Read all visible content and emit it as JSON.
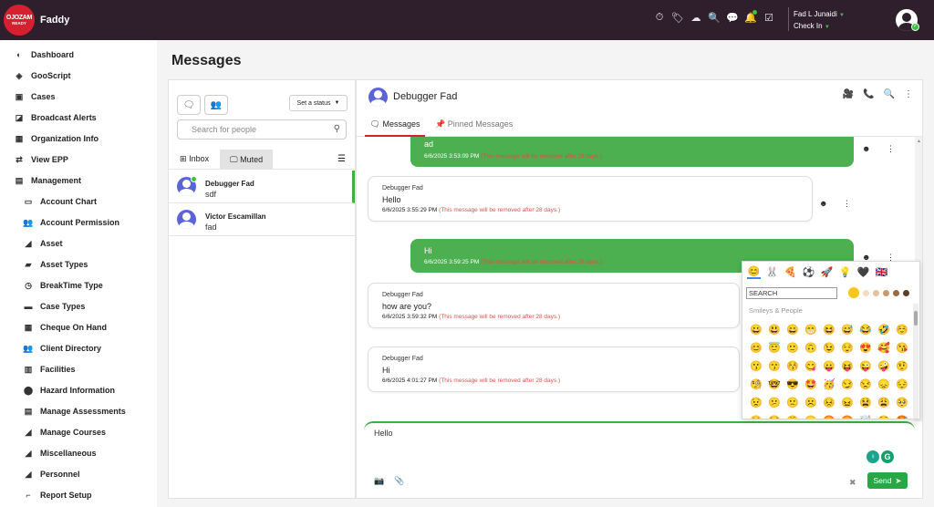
{
  "app": {
    "logo_line1": "OJOZAM",
    "logo_line2": "READY",
    "name": "Faddy",
    "user_name": "Fad L Junaidi",
    "check_in": "Check In",
    "top_icons": [
      "stopwatch-icon",
      "ticket-icon",
      "cloud-icon",
      "search-icon",
      "chat-icon",
      "bell-icon",
      "checklist-icon"
    ]
  },
  "sidebar": {
    "items": [
      {
        "label": "Dashboard",
        "icon": "dashboard-icon",
        "sub": false
      },
      {
        "label": "GooScript",
        "icon": "script-icon",
        "sub": false
      },
      {
        "label": "Cases",
        "icon": "cases-icon",
        "sub": false
      },
      {
        "label": "Broadcast Alerts",
        "icon": "broadcast-icon",
        "sub": false
      },
      {
        "label": "Organization Info",
        "icon": "building-icon",
        "sub": false
      },
      {
        "label": "View EPP",
        "icon": "shuffle-icon",
        "sub": false
      },
      {
        "label": "Management",
        "icon": "management-icon",
        "sub": false
      },
      {
        "label": "Account Chart",
        "icon": "book-icon",
        "sub": true
      },
      {
        "label": "Account Permission",
        "icon": "users-icon",
        "sub": true
      },
      {
        "label": "Asset",
        "icon": "tag-icon",
        "sub": true
      },
      {
        "label": "Asset Types",
        "icon": "box-icon",
        "sub": true
      },
      {
        "label": "BreakTime Type",
        "icon": "clock-icon",
        "sub": true
      },
      {
        "label": "Case Types",
        "icon": "folder-icon",
        "sub": true
      },
      {
        "label": "Cheque On Hand",
        "icon": "cheque-icon",
        "sub": true
      },
      {
        "label": "Client Directory",
        "icon": "users-icon",
        "sub": true
      },
      {
        "label": "Facilities",
        "icon": "facilities-icon",
        "sub": true
      },
      {
        "label": "Hazard Information",
        "icon": "pin-icon",
        "sub": true
      },
      {
        "label": "Manage Assessments",
        "icon": "assessment-icon",
        "sub": true
      },
      {
        "label": "Manage Courses",
        "icon": "tag-icon",
        "sub": true
      },
      {
        "label": "Miscellaneous",
        "icon": "misc-icon",
        "sub": true
      },
      {
        "label": "Personnel",
        "icon": "tag-icon",
        "sub": true
      },
      {
        "label": "Report Setup",
        "icon": "report-icon",
        "sub": true
      }
    ]
  },
  "page": {
    "title": "Messages"
  },
  "left_panel": {
    "status_button": "Set a status",
    "search_placeholder": "Search for people",
    "tab_inbox": "Inbox",
    "tab_muted": "Muted",
    "contacts": [
      {
        "name": "Debugger Fad",
        "last": "sdf",
        "online": true,
        "active": true
      },
      {
        "name": "Victor Escamillan",
        "last": "fad",
        "online": false,
        "active": false
      }
    ]
  },
  "chat": {
    "contact_name": "Debugger Fad",
    "tab_messages": "Messages",
    "tab_pinned": "Pinned Messages",
    "messages": [
      {
        "direction": "out",
        "sender": "",
        "text": "ad",
        "time": "6/6/2025 3:53:09 PM",
        "note": "(This message will be removed after 28 days.)"
      },
      {
        "direction": "in",
        "sender": "Debugger Fad",
        "text": "Hello",
        "time": "6/6/2025 3:55:29 PM",
        "note": "(This message will be removed after 28 days.)"
      },
      {
        "direction": "out",
        "sender": "",
        "text": "Hi",
        "time": "6/6/2025 3:59:25 PM",
        "note": "(This message will be removed after 28 days.)"
      },
      {
        "direction": "in",
        "sender": "Debugger Fad",
        "text": "how are you?",
        "time": "6/6/2025 3:59:32 PM",
        "note": "(This message will be removed after 28 days.)"
      },
      {
        "direction": "in",
        "sender": "Debugger Fad",
        "text": "Hi",
        "time": "6/6/2025 4:01:27 PM",
        "note": "(This message will be removed after 28 days.)"
      }
    ],
    "composer_value": "Hello",
    "send_label": "Send"
  },
  "emoji_picker": {
    "search_placeholder": "SEARCH",
    "category_label": "Smileys & People",
    "categories": [
      "😊",
      "🐰",
      "🍕",
      "⚽",
      "🚀",
      "💡",
      "🖤",
      "🇬🇧"
    ],
    "tones": [
      "#f5c518",
      "#f3dcc0",
      "#e6c29a",
      "#c99a6b",
      "#9a6b44",
      "#5a3f2c"
    ],
    "emojis": [
      "😀",
      "😃",
      "😄",
      "😁",
      "😆",
      "😅",
      "😂",
      "🤣",
      "☺️",
      "😊",
      "😇",
      "🙂",
      "🙃",
      "😉",
      "😌",
      "😍",
      "🥰",
      "😘",
      "😗",
      "😙",
      "😚",
      "😋",
      "😛",
      "😝",
      "😜",
      "🤪",
      "🤨",
      "🧐",
      "🤓",
      "😎",
      "🤩",
      "🥳",
      "😏",
      "😒",
      "😞",
      "😔",
      "😟",
      "😕",
      "🙁",
      "☹️",
      "😣",
      "😖",
      "😫",
      "😩",
      "🥺",
      "😢",
      "😭",
      "😤",
      "😠",
      "😡",
      "🤬",
      "🤯",
      "😳",
      "🥵"
    ]
  }
}
